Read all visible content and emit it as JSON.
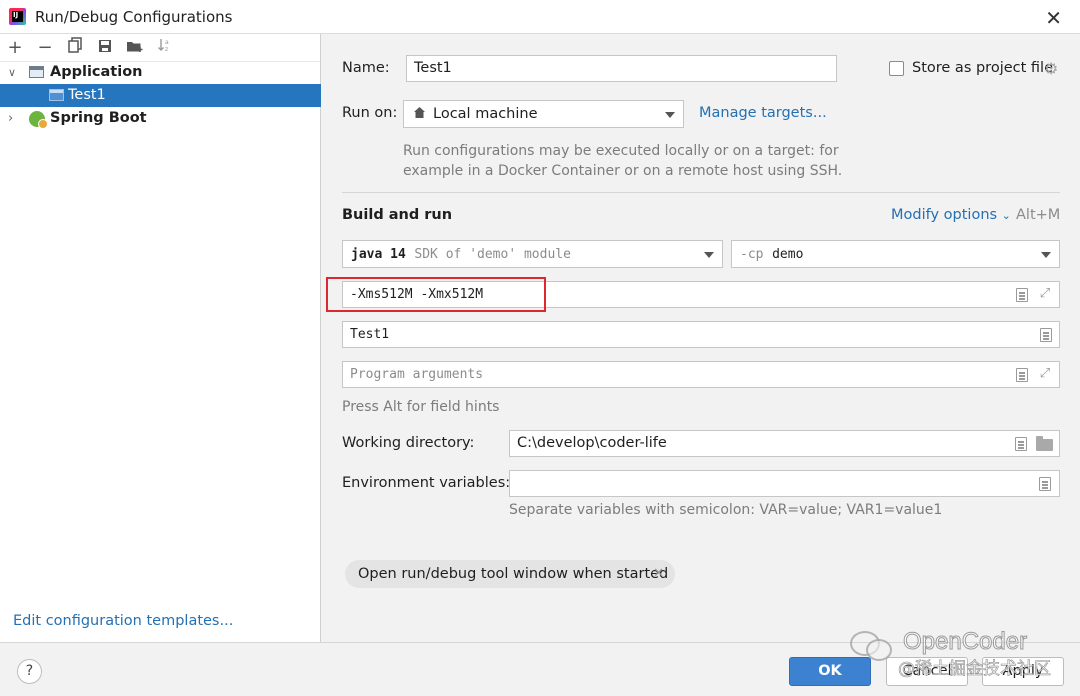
{
  "window": {
    "title": "Run/Debug Configurations"
  },
  "sidebar": {
    "tree": [
      {
        "label": "Application",
        "expanded": true
      },
      {
        "label": "Test1",
        "selected": true
      },
      {
        "label": "Spring Boot",
        "expanded": false
      }
    ],
    "edit_templates_link": "Edit configuration templates..."
  },
  "form": {
    "name_label": "Name:",
    "name_value": "Test1",
    "store_label": "Store as project file",
    "store_checked": false,
    "run_on_label": "Run on:",
    "run_on_value": "Local machine",
    "manage_targets": "Manage targets...",
    "run_on_hint_1": "Run configurations may be executed locally or on a target: for",
    "run_on_hint_2": "example in a Docker Container or on a remote host using SSH.",
    "build_and_run": "Build and run",
    "modify_options": "Modify options",
    "modify_shortcut": "Alt+M",
    "sdk_version": "java 14",
    "sdk_desc": "SDK of 'demo' module",
    "cp_prefix": "-cp",
    "cp_value": "demo",
    "vm_options": "-Xms512M -Xmx512M",
    "main_class": "Test1",
    "program_args_placeholder": "Program arguments",
    "field_hints": "Press Alt for field hints",
    "working_dir_label": "Working directory:",
    "working_dir_value": "C:\\develop\\coder-life",
    "env_label": "Environment variables:",
    "env_value": "",
    "env_hint": "Separate variables with semicolon: VAR=value; VAR1=value1",
    "chip_label": "Open run/debug tool window when started"
  },
  "footer": {
    "help": "?",
    "ok": "OK",
    "cancel": "Cancel",
    "apply": "Apply"
  },
  "watermark": {
    "line1": "OpenCoder",
    "line2": "@稀土掘金技术社区"
  },
  "colors": {
    "selection": "#2675bf",
    "link": "#2470b3",
    "ok_button": "#3d82d1",
    "highlight_box": "#e0262e"
  }
}
